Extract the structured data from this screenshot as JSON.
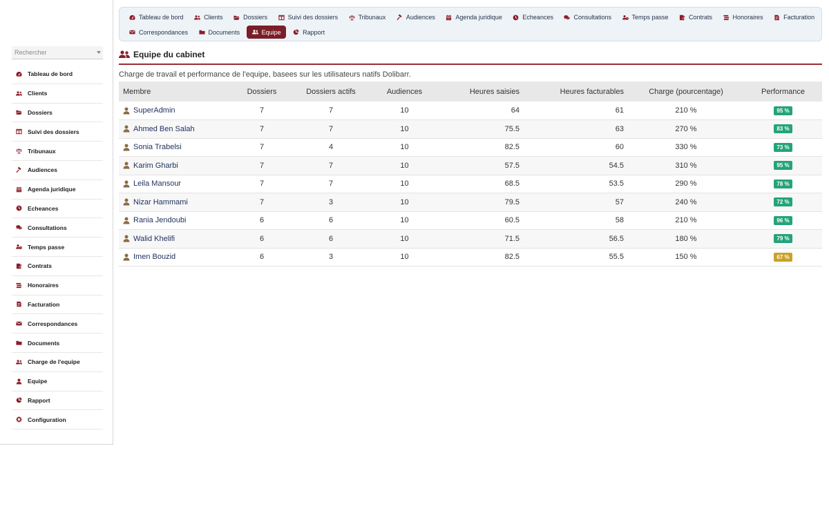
{
  "search": {
    "placeholder": "Rechercher"
  },
  "sidebar": {
    "items": [
      {
        "label": "Tableau de bord",
        "icon": "dashboard-icon"
      },
      {
        "label": "Clients",
        "icon": "users-icon"
      },
      {
        "label": "Dossiers",
        "icon": "folder-open-icon"
      },
      {
        "label": "Suivi des dossiers",
        "icon": "columns-icon"
      },
      {
        "label": "Tribunaux",
        "icon": "balance-icon"
      },
      {
        "label": "Audiences",
        "icon": "gavel-icon"
      },
      {
        "label": "Agenda juridique",
        "icon": "calendar-icon"
      },
      {
        "label": "Echeances",
        "icon": "clock-icon"
      },
      {
        "label": "Consultations",
        "icon": "comments-icon"
      },
      {
        "label": "Temps passe",
        "icon": "user-clock-icon"
      },
      {
        "label": "Contrats",
        "icon": "contract-icon"
      },
      {
        "label": "Honoraires",
        "icon": "money-stack-icon"
      },
      {
        "label": "Facturation",
        "icon": "invoice-icon"
      },
      {
        "label": "Correspondances",
        "icon": "envelope-icon"
      },
      {
        "label": "Documents",
        "icon": "folder-icon"
      },
      {
        "label": "Charge de l'equipe",
        "icon": "users-icon"
      },
      {
        "label": "Equipe",
        "icon": "user-icon"
      },
      {
        "label": "Rapport",
        "icon": "pie-chart-icon"
      },
      {
        "label": "Configuration",
        "icon": "gear-icon"
      }
    ]
  },
  "topnav": {
    "row1": [
      {
        "label": "Tableau de bord",
        "icon": "dashboard-icon"
      },
      {
        "label": "Clients",
        "icon": "users-icon"
      },
      {
        "label": "Dossiers",
        "icon": "folder-open-icon"
      },
      {
        "label": "Suivi des dossiers",
        "icon": "columns-icon"
      },
      {
        "label": "Tribunaux",
        "icon": "balance-icon"
      },
      {
        "label": "Audiences",
        "icon": "gavel-icon"
      },
      {
        "label": "Agenda juridique",
        "icon": "calendar-icon"
      },
      {
        "label": "Echeances",
        "icon": "clock-icon"
      },
      {
        "label": "Consultations",
        "icon": "comments-icon"
      },
      {
        "label": "Temps passe",
        "icon": "user-clock-icon"
      },
      {
        "label": "Contrats",
        "icon": "contract-icon"
      },
      {
        "label": "Honoraires",
        "icon": "money-stack-icon"
      },
      {
        "label": "Facturation",
        "icon": "invoice-icon"
      }
    ],
    "row2": [
      {
        "label": "Correspondances",
        "icon": "envelope-icon"
      },
      {
        "label": "Documents",
        "icon": "folder-icon"
      },
      {
        "label": "Equipe",
        "icon": "users-icon",
        "active": true
      },
      {
        "label": "Rapport",
        "icon": "pie-chart-icon"
      }
    ]
  },
  "page": {
    "title": "Equipe du cabinet",
    "subtitle": "Charge de travail et performance de l'equipe, basees sur les utilisateurs natifs Dolibarr."
  },
  "table": {
    "headers": [
      "Membre",
      "Dossiers",
      "Dossiers actifs",
      "Audiences",
      "Heures saisies",
      "Heures facturables",
      "Charge (pourcentage)",
      "Performance"
    ],
    "rows": [
      {
        "membre": "SuperAdmin",
        "dossiers": "7",
        "actifs": "7",
        "audiences": "10",
        "heures_saisies": "64",
        "heures_facturables": "61",
        "charge": "210 %",
        "performance": "95 %"
      },
      {
        "membre": "Ahmed Ben Salah",
        "dossiers": "7",
        "actifs": "7",
        "audiences": "10",
        "heures_saisies": "75.5",
        "heures_facturables": "63",
        "charge": "270 %",
        "performance": "83 %"
      },
      {
        "membre": "Sonia Trabelsi",
        "dossiers": "7",
        "actifs": "4",
        "audiences": "10",
        "heures_saisies": "82.5",
        "heures_facturables": "60",
        "charge": "330 %",
        "performance": "73 %"
      },
      {
        "membre": "Karim Gharbi",
        "dossiers": "7",
        "actifs": "7",
        "audiences": "10",
        "heures_saisies": "57.5",
        "heures_facturables": "54.5",
        "charge": "310 %",
        "performance": "95 %"
      },
      {
        "membre": "Leila Mansour",
        "dossiers": "7",
        "actifs": "7",
        "audiences": "10",
        "heures_saisies": "68.5",
        "heures_facturables": "53.5",
        "charge": "290 %",
        "performance": "78 %"
      },
      {
        "membre": "Nizar Hammami",
        "dossiers": "7",
        "actifs": "3",
        "audiences": "10",
        "heures_saisies": "79.5",
        "heures_facturables": "57",
        "charge": "240 %",
        "performance": "72 %"
      },
      {
        "membre": "Rania Jendoubi",
        "dossiers": "6",
        "actifs": "6",
        "audiences": "10",
        "heures_saisies": "60.5",
        "heures_facturables": "58",
        "charge": "210 %",
        "performance": "96 %"
      },
      {
        "membre": "Walid Khelifi",
        "dossiers": "6",
        "actifs": "6",
        "audiences": "10",
        "heures_saisies": "71.5",
        "heures_facturables": "56.5",
        "charge": "180 %",
        "performance": "79 %"
      },
      {
        "membre": "Imen Bouzid",
        "dossiers": "6",
        "actifs": "3",
        "audiences": "10",
        "heures_saisies": "82.5",
        "heures_facturables": "55.5",
        "charge": "150 %",
        "performance": "67 %"
      }
    ]
  },
  "colors": {
    "accent": "#7a1e28",
    "icon": "#8b1e2a",
    "badge_good": "#25a37a",
    "badge_warn": "#c8a22a",
    "member_icon": "#8a6a44"
  }
}
